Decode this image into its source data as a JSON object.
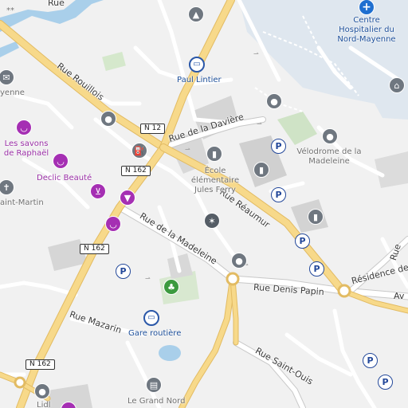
{
  "map": {
    "streets": {
      "rue_top": "Rue",
      "rue_rouillois": "Rue Rouillois",
      "rue_daviere": "Rue de la Davière",
      "rue_reaumur": "Rue Réaumur",
      "rue_madeleine": "Rue de la Madeleine",
      "rue_denis_papin": "Rue Denis Papin",
      "residence": "Résidence de la",
      "av_cut": "Av",
      "rue_mazarin": "Rue Mazarin",
      "rue_saint_ouis": "Rue Saint-Ouis",
      "rue_right": "Rue"
    },
    "road_shields": {
      "n12": "N 12",
      "n162_a": "N 162",
      "n162_b": "N 162",
      "n162_c": "N 162"
    },
    "pois": {
      "hospital": "Centre Hospitalier du Nord-Mayenne",
      "paul_lintier": "Paul Lintier",
      "velodrome": "Vélodrome de la Madeleine",
      "ecole": "École élémentaire Jules Ferry",
      "savons": "Les savons de Raphaël",
      "declic": "Declic Beauté",
      "gare": "Gare routière",
      "grand_nord": "Le Grand Nord",
      "saint_martin": "aint-Martin",
      "lidl": "Lidl",
      "top_left": "**",
      "yenne": "yenne"
    },
    "icons": {
      "hospital": "hospital-icon",
      "bus": "bus-stop-icon",
      "parking": "parking-icon",
      "school": "school-icon",
      "shop": "shop-basket-icon",
      "cart": "shopping-cart-icon",
      "fuel": "fuel-station-icon",
      "park": "tree-icon",
      "sport": "sport-icon",
      "museum": "museum-icon",
      "location": "location-pin-icon",
      "book": "book-icon",
      "mail": "mail-icon",
      "church": "church-icon"
    },
    "colors": {
      "background": "#f1f1f1",
      "main_road": "#f7d98a",
      "water": "#a9cfea",
      "hospital_area": "#dfe7ef",
      "building": "#d5d5d5",
      "park": "#cfe3c6"
    }
  }
}
